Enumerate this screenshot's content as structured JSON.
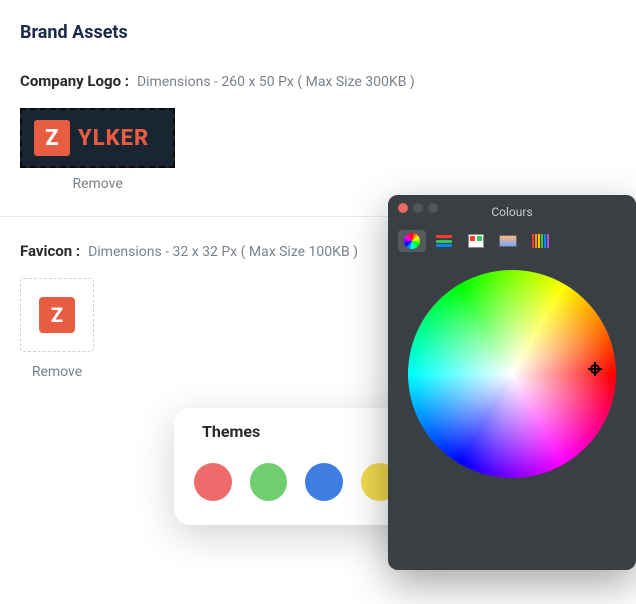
{
  "section_title": "Brand Assets",
  "company_logo": {
    "label": "Company Logo :",
    "hint": "Dimensions - 260 x 50 Px ( Max Size 300KB )",
    "brand_letter": "Z",
    "brand_text": "YLKER",
    "remove": "Remove"
  },
  "favicon": {
    "label": "Favicon :",
    "hint": "Dimensions - 32 x 32 Px ( Max Size 100KB )",
    "letter": "Z",
    "remove": "Remove"
  },
  "themes": {
    "title": "Themes",
    "swatches": [
      "#ef6b6b",
      "#6fcf6f",
      "#3d7ee0",
      "#f2d94e"
    ],
    "add": "+"
  },
  "color_picker": {
    "title": "Colours"
  }
}
